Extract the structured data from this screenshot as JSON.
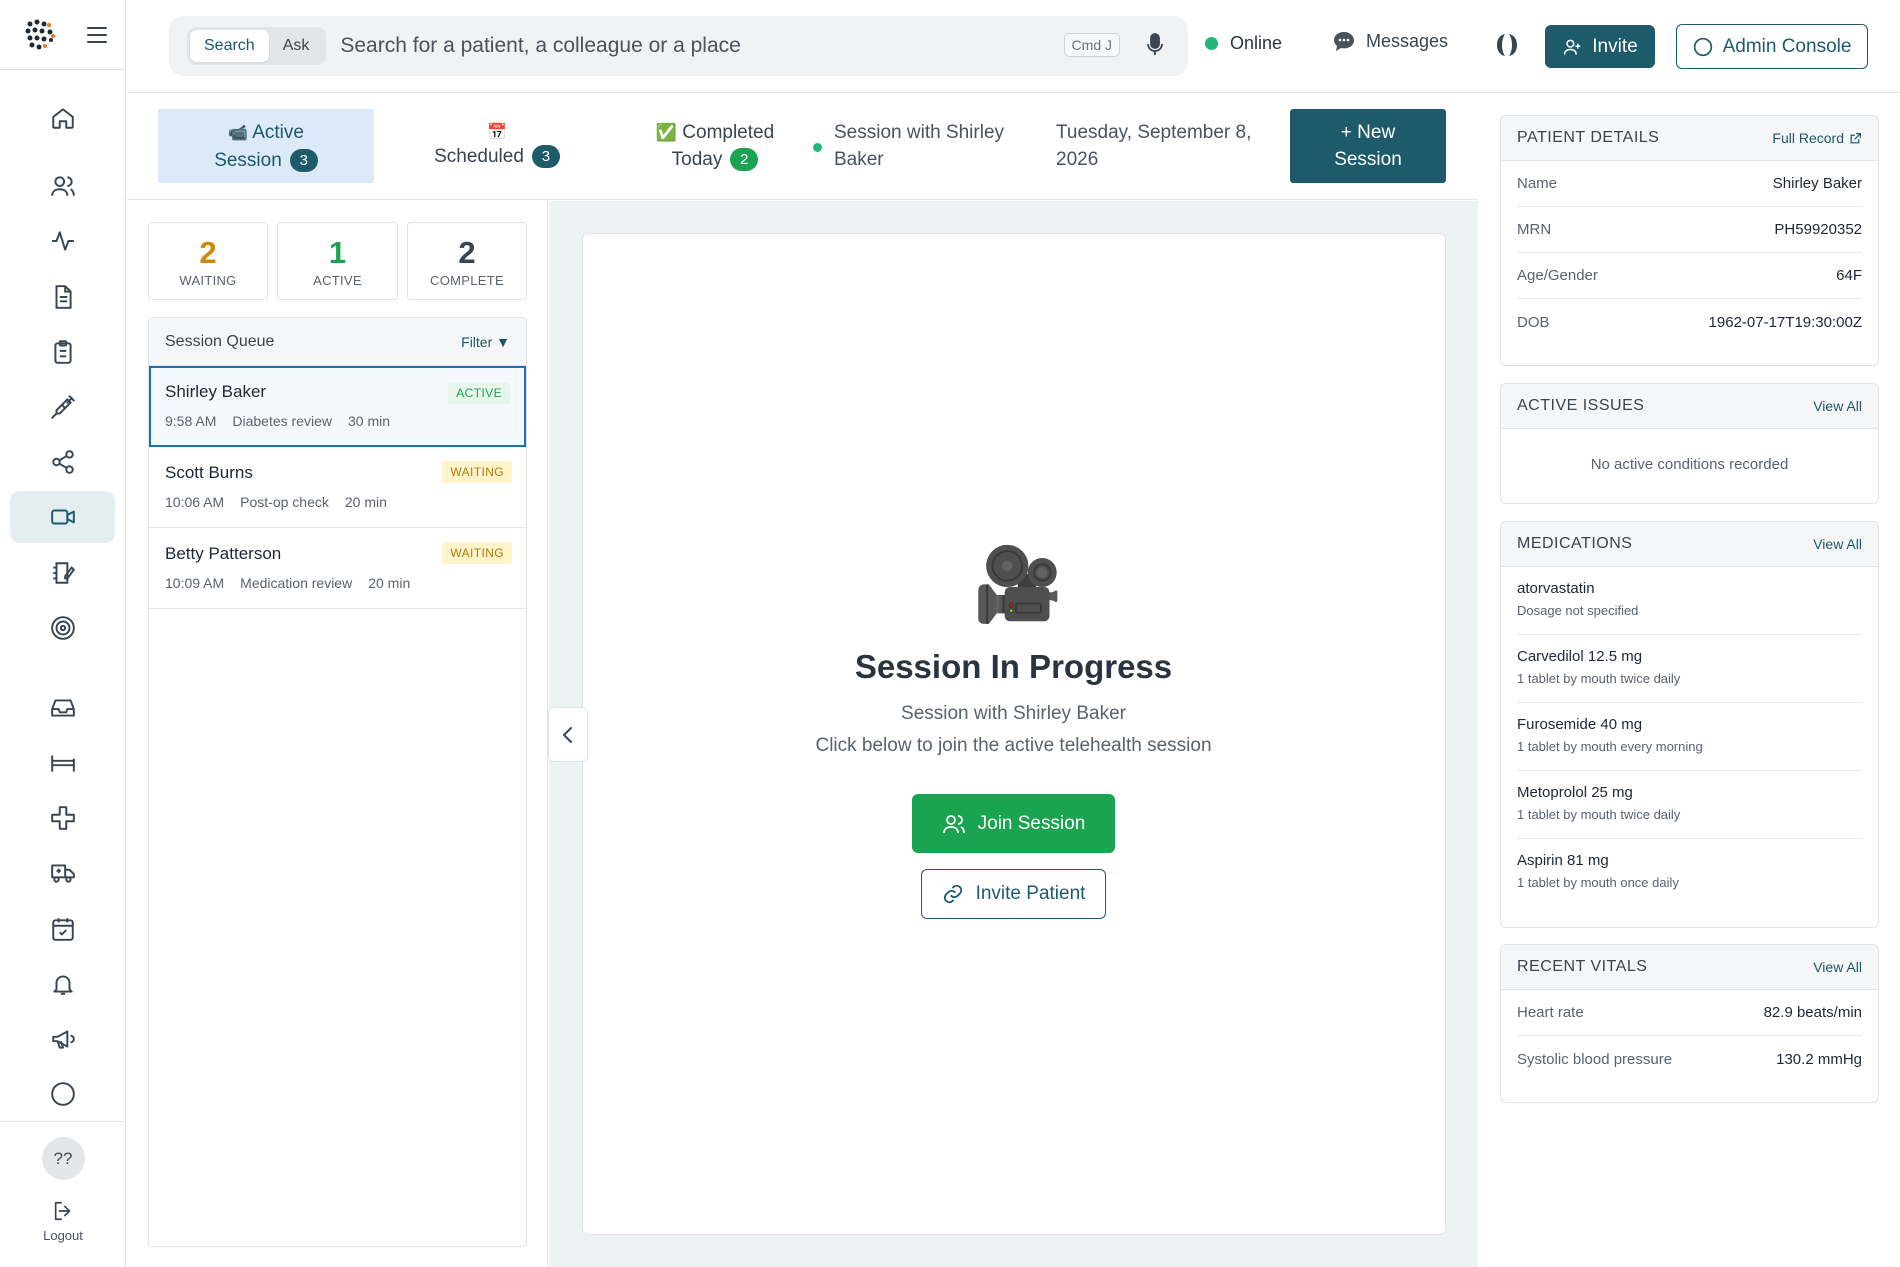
{
  "topbar": {
    "search_modes": [
      "Search",
      "Ask"
    ],
    "search_placeholder": "Search for a patient, a colleague or a place",
    "shortcut": "Cmd J",
    "status": "Online",
    "messages": "Messages",
    "invite": "Invite",
    "admin": "Admin Console"
  },
  "rail": {
    "icons": [
      "home-icon",
      "users-icon",
      "activity-icon",
      "document-icon",
      "clipboard-icon",
      "syringe-icon",
      "share-icon",
      "video-icon",
      "notebook-icon",
      "target-icon",
      "inbox-icon",
      "bed-icon",
      "medical-cross-icon",
      "ambulance-icon",
      "calendar-icon",
      "bell-icon",
      "megaphone-icon",
      "circle-icon"
    ],
    "help": "??",
    "logout": "Logout"
  },
  "tabs": {
    "active": {
      "icon": "📹",
      "line1": "Active",
      "line2": "Session",
      "count": "3"
    },
    "scheduled": {
      "icon": "📅",
      "label": "Scheduled",
      "count": "3"
    },
    "completed": {
      "icon": "✅",
      "line1": "Completed",
      "line2": "Today",
      "count": "2"
    },
    "session_with_line1": "Session with Shirley",
    "session_with_line2": "Baker",
    "date_line1": "Tuesday, September 8,",
    "date_line2": "2026",
    "new_session_line1": "+ New",
    "new_session_line2": "Session"
  },
  "stats": [
    {
      "value": "2",
      "label": "WAITING",
      "color": "#c98a0a"
    },
    {
      "value": "1",
      "label": "ACTIVE",
      "color": "#1aa350"
    },
    {
      "value": "2",
      "label": "COMPLETE",
      "color": "#3a4450"
    }
  ],
  "queue": {
    "title": "Session Queue",
    "filter": "Filter ▼",
    "items": [
      {
        "name": "Shirley Baker",
        "time": "9:58 AM",
        "type": "Diabetes review",
        "duration": "30 min",
        "status": "ACTIVE"
      },
      {
        "name": "Scott Burns",
        "time": "10:06 AM",
        "type": "Post-op check",
        "duration": "20 min",
        "status": "WAITING"
      },
      {
        "name": "Betty Patterson",
        "time": "10:09 AM",
        "type": "Medication review",
        "duration": "20 min",
        "status": "WAITING"
      }
    ]
  },
  "center": {
    "icon": "🎥",
    "title": "Session In Progress",
    "subtitle": "Session with Shirley Baker",
    "hint": "Click below to join the active telehealth session",
    "join": "Join Session",
    "invite": "Invite Patient"
  },
  "patient": {
    "title": "PATIENT DETAILS",
    "link": "Full Record",
    "fields": [
      {
        "k": "Name",
        "v": "Shirley Baker"
      },
      {
        "k": "MRN",
        "v": "PH59920352"
      },
      {
        "k": "Age/Gender",
        "v": "64F"
      },
      {
        "k": "DOB",
        "v": "1962-07-17T19:30:00Z"
      }
    ]
  },
  "issues": {
    "title": "ACTIVE ISSUES",
    "link": "View All",
    "empty": "No active conditions recorded"
  },
  "meds": {
    "title": "MEDICATIONS",
    "link": "View All",
    "items": [
      {
        "name": "atorvastatin",
        "dose": "Dosage not specified"
      },
      {
        "name": "Carvedilol 12.5 mg",
        "dose": "1 tablet by mouth twice daily"
      },
      {
        "name": "Furosemide 40 mg",
        "dose": "1 tablet by mouth every morning"
      },
      {
        "name": "Metoprolol 25 mg",
        "dose": "1 tablet by mouth twice daily"
      },
      {
        "name": "Aspirin 81 mg",
        "dose": "1 tablet by mouth once daily"
      }
    ]
  },
  "vitals": {
    "title": "RECENT VITALS",
    "link": "View All",
    "items": [
      {
        "k": "Heart rate",
        "v": "82.9 beats/min"
      },
      {
        "k": "Systolic blood pressure",
        "v": "130.2 mmHg"
      }
    ]
  }
}
